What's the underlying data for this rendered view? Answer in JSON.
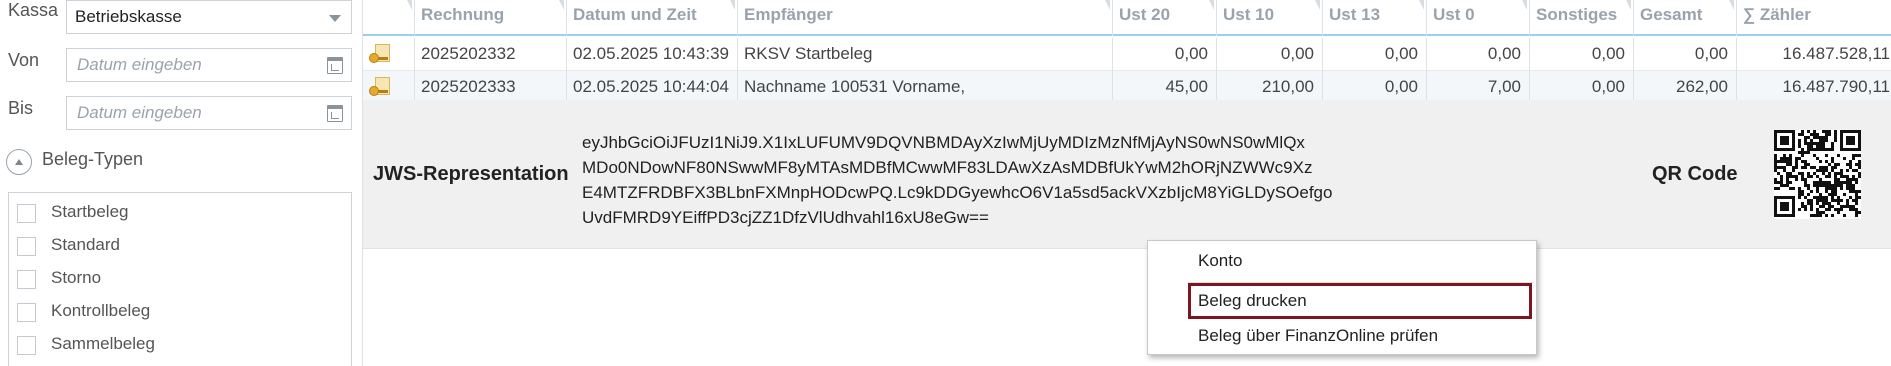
{
  "filters": {
    "kassa": {
      "label": "Kassa",
      "value": "Betriebskasse"
    },
    "von": {
      "label": "Von",
      "placeholder": "Datum eingeben"
    },
    "bis": {
      "label": "Bis",
      "placeholder": "Datum eingeben"
    }
  },
  "beleg_types": {
    "header": "Beleg-Typen",
    "items": [
      {
        "label": "Startbeleg",
        "checked": false
      },
      {
        "label": "Standard",
        "checked": false
      },
      {
        "label": "Storno",
        "checked": false
      },
      {
        "label": "Kontrollbeleg",
        "checked": false
      },
      {
        "label": "Sammelbeleg",
        "checked": false
      }
    ]
  },
  "table": {
    "columns": [
      "Rechnung",
      "Datum und Zeit",
      "Empfänger",
      "Ust 20",
      "Ust 10",
      "Ust 13",
      "Ust 0",
      "Sonstiges",
      "Gesamt",
      "∑ Zähler"
    ],
    "rows": [
      {
        "icon": "receipt-key-icon",
        "cells": [
          "2025202332",
          "02.05.2025 10:43:39",
          "RKSV Startbeleg",
          "0,00",
          "0,00",
          "0,00",
          "0,00",
          "0,00",
          "0,00",
          "16.487.528,11"
        ]
      },
      {
        "icon": "receipt-key-icon",
        "cells": [
          "2025202333",
          "02.05.2025 10:44:04",
          "Nachname 100531 Vorname,",
          "45,00",
          "210,00",
          "0,00",
          "7,00",
          "0,00",
          "262,00",
          "16.487.790,11"
        ]
      }
    ]
  },
  "detail": {
    "jws_label": "JWS-Representation",
    "jws_lines": [
      "eyJhbGciOiJFUzI1NiJ9.X1IxLUFUMV9DQVNBMDAyXzIwMjUyMDIzMzNfMjAyNS0wNS0wMlQx",
      "MDo0NDowNF80NSwwMF8yMTAsMDBfMCwwMF83LDAwXzAsMDBfUkYwM2hORjNZWWc9Xz",
      "E4MTZFRDBFX3BLbnFXMnpHODcwPQ.Lc9kDDGyewhcO6V1a5sd5ackVXzbIjcM8YiGLDySOefgo",
      "UvdFMRD9YEiffPD3cjZZ1DfzVlUdhvahl16xU8eGw=="
    ],
    "qr_label": "QR Code"
  },
  "context_menu": {
    "items": [
      {
        "label": "Konto"
      },
      {
        "label": "Beleg drucken",
        "highlighted": true
      },
      {
        "label": "Beleg über FinanzOnline prüfen"
      }
    ]
  },
  "colors": {
    "header_underline": "#9fcfe6",
    "highlight_border": "#7d1620",
    "detail_background": "#f0f0f0"
  }
}
